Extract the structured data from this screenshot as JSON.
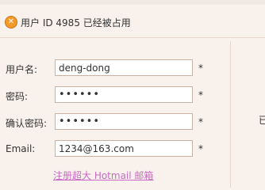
{
  "alert": {
    "icon": "error-icon",
    "message": "用户 ID 4985 已经被占用"
  },
  "form": {
    "username": {
      "label": "用户名:",
      "value": "deng-dong",
      "required_mark": "*"
    },
    "password": {
      "label": "密码:",
      "value": "••••••",
      "required_mark": "*"
    },
    "confirm_password": {
      "label": "确认密码:",
      "value": "••••••",
      "required_mark": "*"
    },
    "email": {
      "label": "Email:",
      "value": "1234@163.com",
      "required_mark": "*"
    }
  },
  "hotmail_link": "注册超大 Hotmail 邮箱",
  "right_panel": {
    "cutoff_text": "已"
  },
  "colors": {
    "background": "#f8f1ec",
    "alert_icon": "#f39a28",
    "link": "#c86ac4",
    "input_border": "#c9b2a4"
  }
}
